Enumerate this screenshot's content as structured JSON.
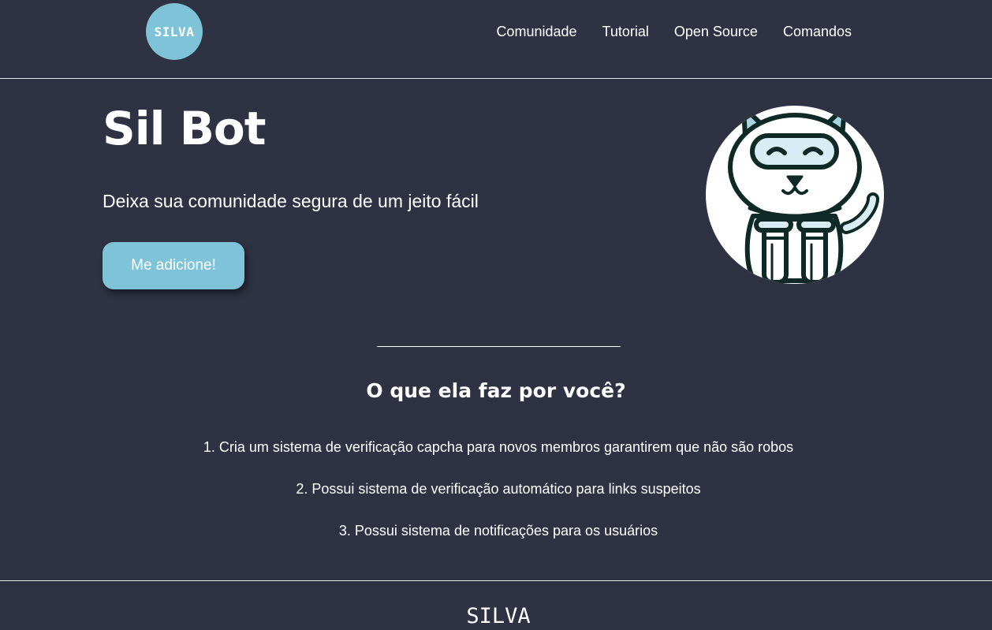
{
  "header": {
    "logo_text": "SILVA",
    "nav": [
      {
        "label": "Comunidade"
      },
      {
        "label": "Tutorial"
      },
      {
        "label": "Open Source"
      },
      {
        "label": "Comandos"
      }
    ]
  },
  "hero": {
    "title": "Sil Bot",
    "subtitle": "Deixa sua comunidade segura de um jeito fácil",
    "button_label": "Me adicione!",
    "mascot_icon": "robot-cat-icon"
  },
  "features": {
    "title": "O que ela faz por você?",
    "items": [
      "1. Cria um sistema de verificação capcha para novos membros garantirem que não são robos",
      "2. Possui sistema de verificação automático para links suspeitos",
      "3. Possui sistema de notificações para os usuários"
    ]
  },
  "footer": {
    "brand": "SILVA"
  },
  "colors": {
    "background": "#2e3242",
    "accent": "#7ec3d8",
    "text": "#ffffff"
  }
}
